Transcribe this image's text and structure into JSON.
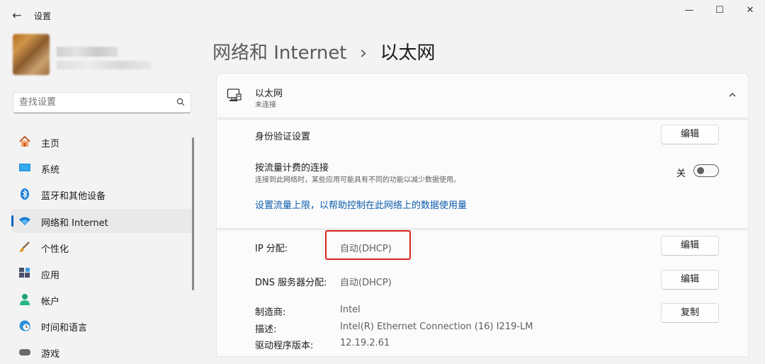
{
  "window": {
    "title": "设置",
    "back_glyph": "←",
    "minimize_glyph": "—",
    "maximize_glyph": "☐",
    "close_glyph": "✕"
  },
  "search": {
    "placeholder": "查找设置"
  },
  "sidebar": {
    "items": [
      {
        "label": "主页",
        "icon": "home-icon"
      },
      {
        "label": "系统",
        "icon": "display-icon"
      },
      {
        "label": "蓝牙和其他设备",
        "icon": "bluetooth-icon"
      },
      {
        "label": "网络和 Internet",
        "icon": "wifi-icon",
        "selected": true
      },
      {
        "label": "个性化",
        "icon": "brush-icon"
      },
      {
        "label": "应用",
        "icon": "apps-icon"
      },
      {
        "label": "帐户",
        "icon": "account-icon"
      },
      {
        "label": "时间和语言",
        "icon": "clock-globe-icon"
      },
      {
        "label": "游戏",
        "icon": "game-icon"
      }
    ]
  },
  "breadcrumb": {
    "parent": "网络和 Internet",
    "separator": "›",
    "current": "以太网"
  },
  "adapter": {
    "name": "以太网",
    "status": "未连接"
  },
  "settings": {
    "auth_label": "身份验证设置",
    "edit_label": "编辑",
    "metered_label": "按流量计费的连接",
    "metered_desc": "连接到此网络时，某些应用可能具有不同的功能以减少数据使用。",
    "metered_state": "关",
    "metered_on": false,
    "data_limit_link": "设置流量上限，以帮助控制在此网络上的数据使用量",
    "ip_label": "IP 分配:",
    "ip_value": "自动(DHCP)",
    "dns_label": "DNS 服务器分配:",
    "dns_value": "自动(DHCP)",
    "manufacturer_label": "制造商:",
    "manufacturer_value": "Intel",
    "description_label": "描述:",
    "description_value": "Intel(R) Ethernet Connection (16) I219-LM",
    "driver_label": "驱动程序版本:",
    "driver_value": "12.19.2.61",
    "copy_label": "复制"
  },
  "colors": {
    "accent": "#0067c0",
    "link": "#0b5cad",
    "highlight_box": "#d9261c"
  }
}
